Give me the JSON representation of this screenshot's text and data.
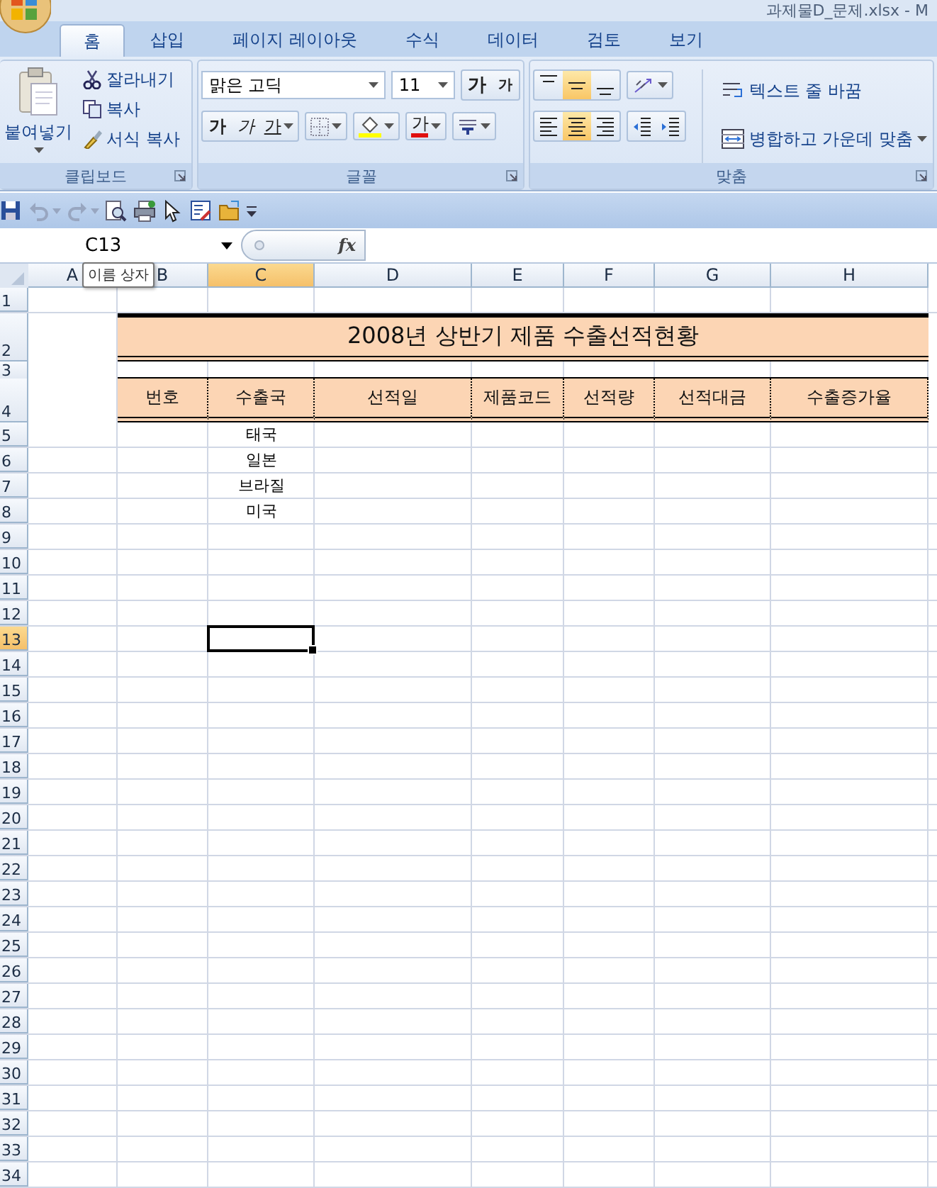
{
  "window": {
    "title": "과제물D_문제.xlsx - M"
  },
  "ribbon_tabs": [
    {
      "label": "홈",
      "selected": true
    },
    {
      "label": "삽입",
      "selected": false
    },
    {
      "label": "페이지 레이아웃",
      "selected": false
    },
    {
      "label": "수식",
      "selected": false
    },
    {
      "label": "데이터",
      "selected": false
    },
    {
      "label": "검토",
      "selected": false
    },
    {
      "label": "보기",
      "selected": false
    }
  ],
  "clipboard_group": {
    "title": "클립보드",
    "paste": "붙여넣기",
    "cut": "잘라내기",
    "copy": "복사",
    "format_painter": "서식 복사"
  },
  "font_group": {
    "title": "글꼴",
    "font_name": "맑은 고딕",
    "font_size": "11",
    "grow_font": "가",
    "shrink_font": "가",
    "bold": "가",
    "italic": "가",
    "underline": "가",
    "font_color": "가"
  },
  "alignment_group": {
    "title": "맞춤",
    "vertical_align": [
      {
        "selected": false
      },
      {
        "selected": true
      },
      {
        "selected": false
      }
    ],
    "horizontal_align": [
      {
        "selected": false
      },
      {
        "selected": true
      },
      {
        "selected": false
      }
    ],
    "wrap_text": "텍스트 줄 바꿈",
    "merge_center": "병합하고 가운데 맞춤"
  },
  "name_box": {
    "value": "C13"
  },
  "name_box_tooltip": "이름 상자",
  "formula_bar": {
    "function_label": "fx"
  },
  "columns": [
    {
      "label": "A",
      "selected": false
    },
    {
      "label": "B",
      "selected": false
    },
    {
      "label": "C",
      "selected": true
    },
    {
      "label": "D",
      "selected": false
    },
    {
      "label": "E",
      "selected": false
    },
    {
      "label": "F",
      "selected": false
    },
    {
      "label": "G",
      "selected": false
    },
    {
      "label": "H",
      "selected": false
    }
  ],
  "rows": [
    {
      "number": "1",
      "kind": "blank",
      "selected": false
    },
    {
      "number": "2",
      "kind": "title",
      "selected": false,
      "text": "2008년 상반기 제품 수출선적현황"
    },
    {
      "number": "3",
      "kind": "spacer",
      "selected": false
    },
    {
      "number": "4",
      "kind": "header",
      "selected": false,
      "cells": [
        "번호",
        "수출국",
        "선적일",
        "제품코드",
        "선적량",
        "선적대금",
        "수출증가율"
      ]
    },
    {
      "number": "5",
      "kind": "data",
      "selected": false,
      "country": "태국"
    },
    {
      "number": "6",
      "kind": "data",
      "selected": false,
      "country": "일본"
    },
    {
      "number": "7",
      "kind": "data",
      "selected": false,
      "country": "브라질"
    },
    {
      "number": "8",
      "kind": "data",
      "selected": false,
      "country": "미국"
    },
    {
      "number": "9",
      "kind": "blank",
      "selected": false
    },
    {
      "number": "10",
      "kind": "blank",
      "selected": false
    },
    {
      "number": "11",
      "kind": "blank",
      "selected": false
    },
    {
      "number": "12",
      "kind": "blank",
      "selected": false
    },
    {
      "number": "13",
      "kind": "blank",
      "selected": true
    },
    {
      "number": "14",
      "kind": "blank",
      "selected": false
    },
    {
      "number": "15",
      "kind": "blank",
      "selected": false
    },
    {
      "number": "16",
      "kind": "blank",
      "selected": false
    },
    {
      "number": "17",
      "kind": "blank",
      "selected": false
    },
    {
      "number": "18",
      "kind": "blank",
      "selected": false
    },
    {
      "number": "19",
      "kind": "blank",
      "selected": false
    },
    {
      "number": "20",
      "kind": "blank",
      "selected": false
    },
    {
      "number": "21",
      "kind": "blank",
      "selected": false
    },
    {
      "number": "22",
      "kind": "blank",
      "selected": false
    },
    {
      "number": "23",
      "kind": "blank",
      "selected": false
    },
    {
      "number": "24",
      "kind": "blank",
      "selected": false
    },
    {
      "number": "25",
      "kind": "blank",
      "selected": false
    },
    {
      "number": "26",
      "kind": "blank",
      "selected": false
    },
    {
      "number": "27",
      "kind": "blank",
      "selected": false
    },
    {
      "number": "28",
      "kind": "blank",
      "selected": false
    },
    {
      "number": "29",
      "kind": "blank",
      "selected": false
    },
    {
      "number": "30",
      "kind": "blank",
      "selected": false
    },
    {
      "number": "31",
      "kind": "blank",
      "selected": false
    },
    {
      "number": "32",
      "kind": "blank",
      "selected": false
    },
    {
      "number": "33",
      "kind": "blank",
      "selected": false
    },
    {
      "number": "34",
      "kind": "blank",
      "selected": false
    }
  ]
}
